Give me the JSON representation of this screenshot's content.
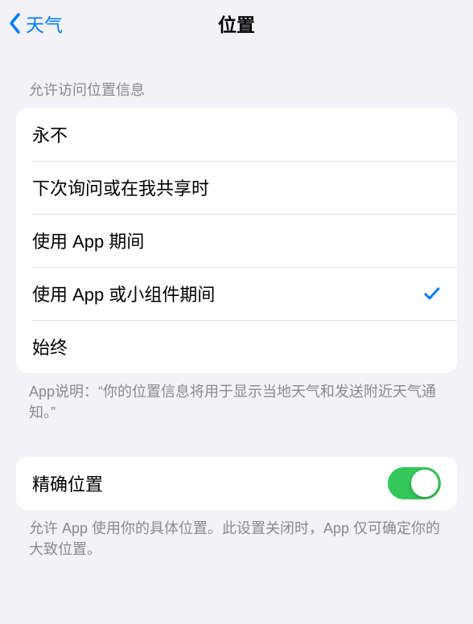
{
  "nav": {
    "back_label": "天气",
    "title": "位置"
  },
  "section1": {
    "header": "允许访问位置信息",
    "options": [
      {
        "label": "永不",
        "selected": false
      },
      {
        "label": "下次询问或在我共享时",
        "selected": false
      },
      {
        "label": "使用 App 期间",
        "selected": false
      },
      {
        "label": "使用 App 或小组件期间",
        "selected": true
      },
      {
        "label": "始终",
        "selected": false
      }
    ],
    "footer": "App说明：“你的位置信息将用于显示当地天气和发送附近天气通知。”"
  },
  "section2": {
    "precise_label": "精确位置",
    "precise_on": true,
    "footer": "允许 App 使用你的具体位置。此设置关闭时，App 仅可确定你的大致位置。"
  }
}
